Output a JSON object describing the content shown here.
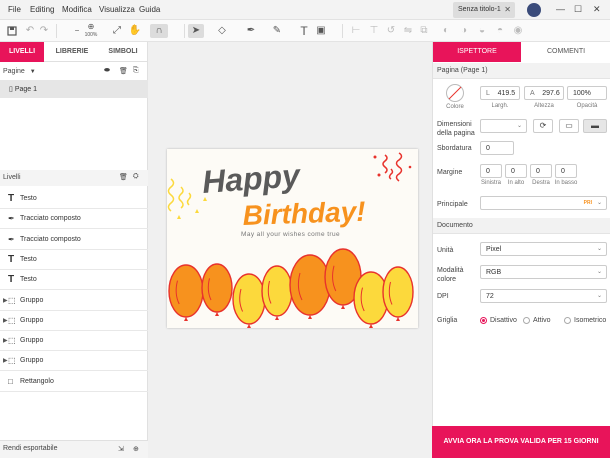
{
  "menu": {
    "file": "File",
    "edit": "Editing",
    "modify": "Modifica",
    "view": "Visualizza",
    "guide": "Guida"
  },
  "document_tab": {
    "title": "Senza titolo-1",
    "close": "✕"
  },
  "window": {
    "minimize": "—",
    "maximize": "☐",
    "close": "✕"
  },
  "toolbar": {
    "zoom": "100%"
  },
  "left_panel": {
    "tabs": [
      "LIVELLI",
      "LIBRERIE",
      "SIMBOLI"
    ],
    "pages_label": "Pagine",
    "page_item": "Page 1",
    "layers_label": "Livelli",
    "layers": [
      {
        "icon": "text-icon",
        "label": "Testo",
        "expandable": false
      },
      {
        "icon": "path-icon",
        "label": "Tracciato composto",
        "expandable": false
      },
      {
        "icon": "path-icon",
        "label": "Tracciato composto",
        "expandable": false
      },
      {
        "icon": "text-icon",
        "label": "Testo",
        "expandable": false
      },
      {
        "icon": "text-icon",
        "label": "Testo",
        "expandable": false
      },
      {
        "icon": "group-icon",
        "label": "Gruppo",
        "expandable": true
      },
      {
        "icon": "group-icon",
        "label": "Gruppo",
        "expandable": true
      },
      {
        "icon": "group-icon",
        "label": "Gruppo",
        "expandable": true
      },
      {
        "icon": "group-icon",
        "label": "Gruppo",
        "expandable": true
      },
      {
        "icon": "rectangle-icon",
        "label": "Rettangolo",
        "expandable": false
      }
    ],
    "export_label": "Rendi esportabile"
  },
  "artwork": {
    "title_line1": "Happy",
    "title_line2": "Birthday!",
    "subtitle": "May all your wishes come true",
    "colors": {
      "dark": "#5a5a5a",
      "orange": "#f7921e",
      "yellow": "#fcd93c",
      "red": "#e8322c"
    }
  },
  "right_panel": {
    "tabs": [
      "ISPETTORE",
      "COMMENTI"
    ],
    "page_section": "Pagina (Page 1)",
    "color_label": "Colore",
    "width_prefix": "L",
    "width_value": "419.5",
    "width_caption": "Largh.",
    "height_prefix": "A",
    "height_value": "297.6",
    "height_caption": "Altezza",
    "opacity_value": "100%",
    "opacity_caption": "Opacità",
    "page_size_label": "Dimensioni della pagina",
    "bleed_label": "Sbordatura",
    "bleed_value": "0",
    "margins_label": "Margine",
    "margins": [
      {
        "value": "0",
        "caption": "Sinistra"
      },
      {
        "value": "0",
        "caption": "In alto"
      },
      {
        "value": "0",
        "caption": "Destra"
      },
      {
        "value": "0",
        "caption": "In basso"
      }
    ],
    "main_label": "Principale",
    "main_badge": "PRI",
    "doc_section": "Documento",
    "unit_label": "Unità",
    "unit_value": "Pixel",
    "color_mode_label": "Modalità colore",
    "color_mode_value": "RGB",
    "dpi_label": "DPI",
    "dpi_value": "72",
    "grid_label": "Griglia",
    "grid_options": [
      "Disattivo",
      "Attivo",
      "Isometrico"
    ],
    "grid_selected": "Disattivo"
  },
  "promo": "AVVIA ORA LA PROVA VALIDA PER 15 GIORNI",
  "accent_color": "#e8145a"
}
